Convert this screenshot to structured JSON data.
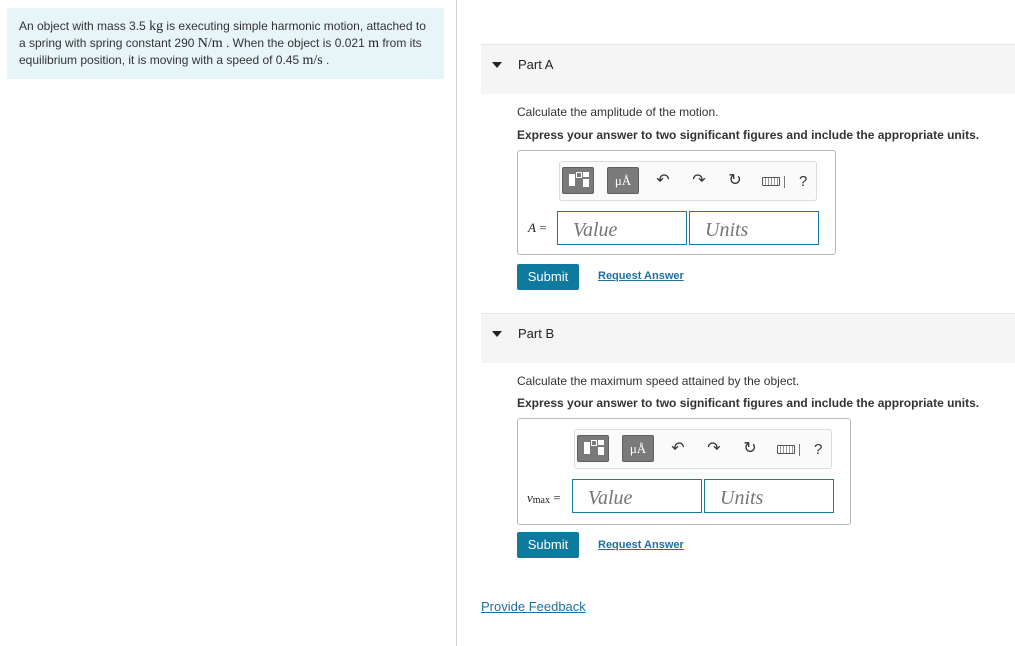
{
  "problem": {
    "text_1": "An object with mass 3.5 ",
    "unit_kg": "kg",
    "text_2": " is executing simple harmonic motion, attached to a spring with spring constant 290 ",
    "unit_nm": "N/m",
    "text_3": " . When the object is 0.021 ",
    "unit_m": "m",
    "text_4": " from its equilibrium position, it is moving with a speed of 0.45 ",
    "unit_ms": "m/s",
    "text_5": " ."
  },
  "toolbar": {
    "symbols_label": "μÅ",
    "undo_icon": "undo-icon",
    "redo_icon": "redo-icon",
    "reset_icon": "reset-icon",
    "keyboard_icon": "keyboard-icon",
    "help_label": "?"
  },
  "parts": [
    {
      "title": "Part A",
      "question": "Calculate the amplitude of the motion.",
      "instruction": "Express your answer to two significant figures and include the appropriate units.",
      "variable": "A",
      "variable_sub": "",
      "equals": "=",
      "value_placeholder": "Value",
      "units_placeholder": "Units",
      "submit_label": "Submit",
      "request_label": "Request Answer"
    },
    {
      "title": "Part B",
      "question": "Calculate the maximum speed attained by the object.",
      "instruction": "Express your answer to two significant figures and include the appropriate units.",
      "variable": "v",
      "variable_sub": "max",
      "equals": "=",
      "value_placeholder": "Value",
      "units_placeholder": "Units",
      "submit_label": "Submit",
      "request_label": "Request Answer"
    }
  ],
  "feedback_label": "Provide Feedback",
  "colors": {
    "problem_bg": "#e8f5f8",
    "accent": "#0f7aa0",
    "link": "#1f6fa0",
    "field_border": "#1f7aa0"
  }
}
